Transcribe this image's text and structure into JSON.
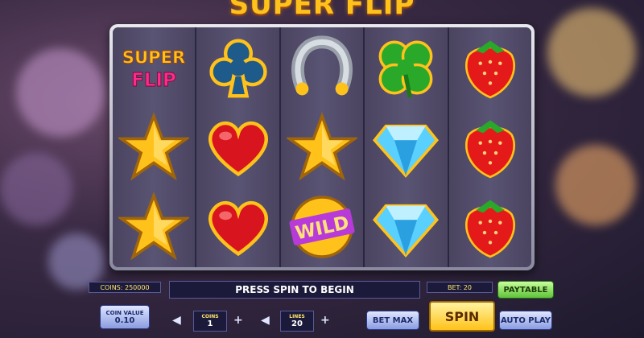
{
  "logo": {
    "text": "SUPER FLIP"
  },
  "reels": [
    [
      "super-flip-logo",
      "star",
      "star"
    ],
    [
      "club",
      "heart",
      "heart"
    ],
    [
      "horseshoe",
      "star",
      "wild"
    ],
    [
      "clover",
      "diamond",
      "diamond"
    ],
    [
      "strawberry",
      "strawberry",
      "strawberry"
    ]
  ],
  "symbols": {
    "super_top": "SUPER",
    "super_bottom": "FLIP",
    "wild": "WILD"
  },
  "colors": {
    "accent": "#ffc21a",
    "paytable": "#7ee05a",
    "spin": "#ffd21f"
  },
  "hud": {
    "coins_label": "COINS: 250000",
    "message": "PRESS SPIN TO BEGIN",
    "bet_label": "BET: 20",
    "coin_value_label": "COIN VALUE",
    "coin_value": "0.10",
    "coins_title": "COINS",
    "coins_value": "1",
    "lines_title": "LINES",
    "lines_value": "20",
    "bet_max": "BET MAX",
    "spin": "SPIN",
    "paytable": "PAYTABLE",
    "auto_play": "AUTO PLAY",
    "minus": "◀",
    "plus": "+"
  }
}
